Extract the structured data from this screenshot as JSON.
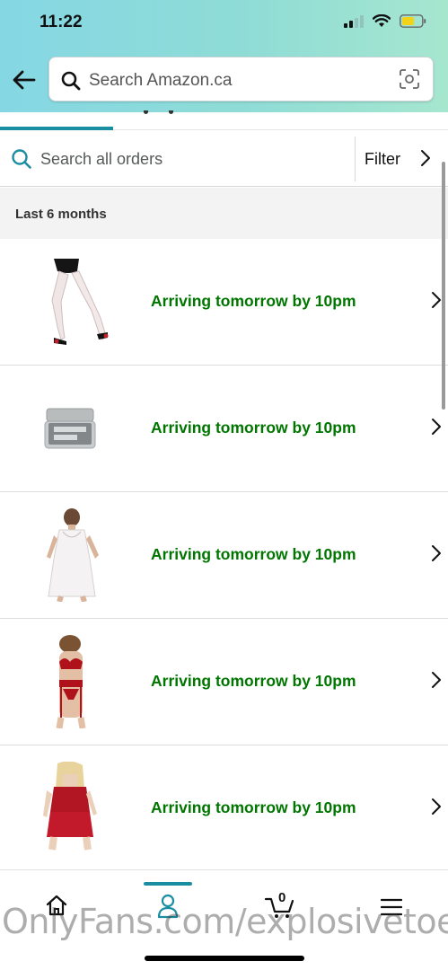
{
  "status_bar": {
    "time": "11:22"
  },
  "header": {
    "search_placeholder": "Search Amazon.ca",
    "icons": {
      "back": "back-arrow-icon",
      "search": "search-icon",
      "camera": "camera-scan-icon"
    }
  },
  "orders_search": {
    "placeholder": "Search all orders",
    "filter_label": "Filter"
  },
  "section": {
    "title": "Last 6 months"
  },
  "orders": [
    {
      "status": "Arriving tomorrow by 10pm",
      "product_image": "white-stockings-heels"
    },
    {
      "status": "Arriving tomorrow by 10pm",
      "product_image": "unicorn-snot-glitter-jar"
    },
    {
      "status": "Arriving tomorrow by 10pm",
      "product_image": "white-lace-babydoll"
    },
    {
      "status": "Arriving tomorrow by 10pm",
      "product_image": "red-lingerie-set"
    },
    {
      "status": "Arriving tomorrow by 10pm",
      "product_image": "red-velvet-pajama-set"
    }
  ],
  "bottom_nav": {
    "items": [
      "home-icon",
      "account-icon",
      "cart-icon",
      "menu-icon"
    ],
    "cart_count": "0",
    "active": "account-icon"
  },
  "watermark": "OnlyFans.com/explosivetoe",
  "colors": {
    "accent": "#1a8ea0",
    "delivery_green": "#007600",
    "header_gradient_start": "#85d7e4",
    "header_gradient_end": "#a6e6cf"
  }
}
